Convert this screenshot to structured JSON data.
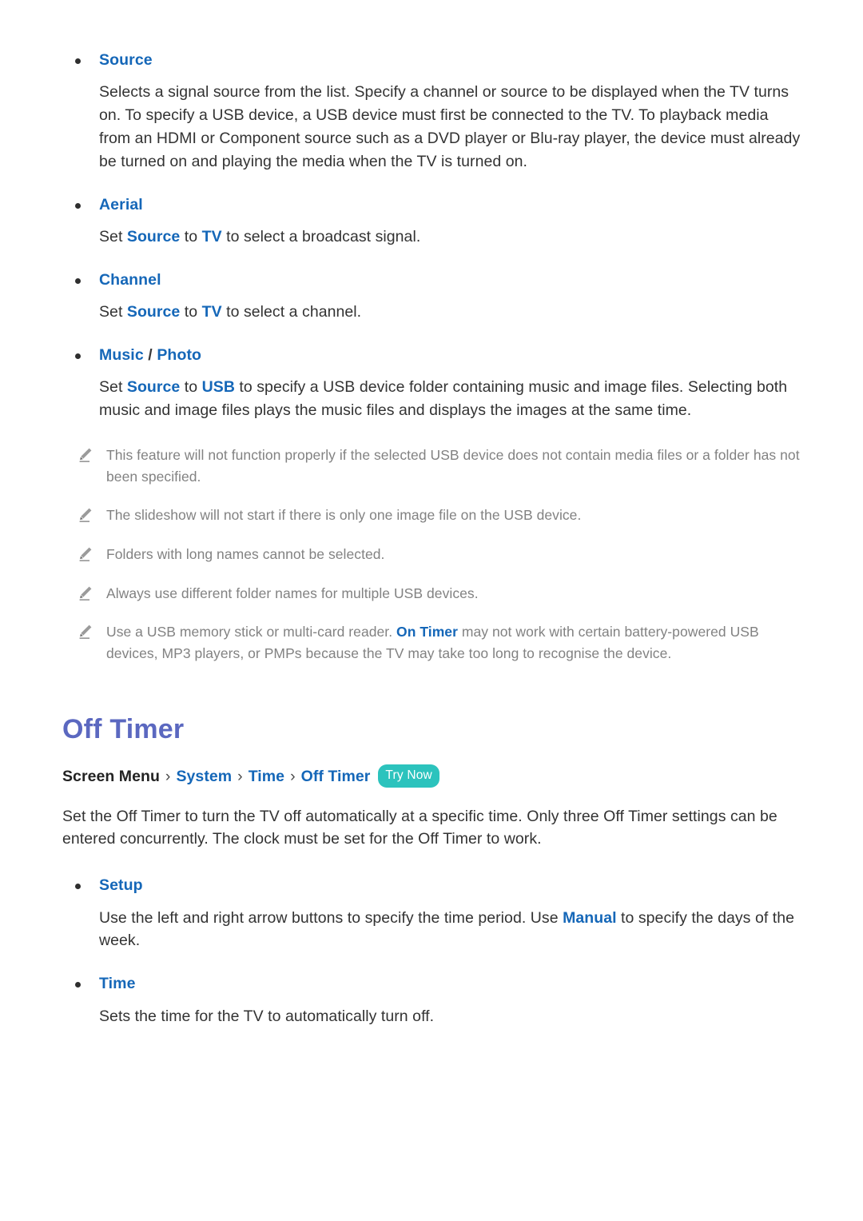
{
  "colors": {
    "link_blue": "#1567b8",
    "heading_purple": "#5b68c0",
    "badge_teal": "#2cc3bd",
    "body_text": "#333333",
    "note_text": "#828282",
    "page_background": "#ffffff"
  },
  "section_top": {
    "items": [
      {
        "label": "Source",
        "label_parts": [
          {
            "text": "Source",
            "style": "link"
          }
        ],
        "body": "Selects a signal source from the list. Specify a channel or source to be displayed when the TV turns on. To specify a USB device, a USB device must first be connected to the TV. To playback media from an HDMI or Component source such as a DVD player or Blu-ray player, the device must already be turned on and playing the media when the TV is turned on."
      },
      {
        "label": "Aerial",
        "body_prefix": "Set ",
        "body_link1": "Source",
        "body_mid": " to ",
        "body_link2": "TV",
        "body_suffix": " to select a broadcast signal."
      },
      {
        "label": "Channel",
        "body_prefix": "Set ",
        "body_link1": "Source",
        "body_mid": " to ",
        "body_link2": "TV",
        "body_suffix": " to select a channel."
      },
      {
        "label_a": "Music",
        "label_sep": " / ",
        "label_b": "Photo",
        "body_prefix": "Set ",
        "body_link1": "Source",
        "body_mid": " to ",
        "body_link2": "USB",
        "body_suffix": " to specify a USB device folder containing music and image files. Selecting both music and image files plays the music files and displays the images at the same time."
      }
    ],
    "notes": [
      {
        "icon": "pencil-icon",
        "text": "This feature will not function properly if the selected USB device does not contain media files or a folder has not been specified."
      },
      {
        "icon": "pencil-icon",
        "text": "The slideshow will not start if there is only one image file on the USB device."
      },
      {
        "icon": "pencil-icon",
        "text": "Folders with long names cannot be selected."
      },
      {
        "icon": "pencil-icon",
        "text": "Always use different folder names for multiple USB devices."
      },
      {
        "icon": "pencil-icon",
        "text_prefix": "Use a USB memory stick or multi-card reader. ",
        "text_link": "On Timer",
        "text_suffix": " may not work with certain battery-powered USB devices, MP3 players, or PMPs because the TV may take too long to recognise the device."
      }
    ]
  },
  "section_off_timer": {
    "heading": "Off Timer",
    "breadcrumb": {
      "root": "Screen Menu",
      "separator": "›",
      "crumbs": [
        "System",
        "Time",
        "Off Timer"
      ],
      "badge": "Try Now"
    },
    "intro": "Set the Off Timer to turn the TV off automatically at a specific time. Only three Off Timer settings can be entered concurrently. The clock must be set for the Off Timer to work.",
    "items": [
      {
        "label": "Setup",
        "body_prefix": "Use the left and right arrow buttons to specify the time period. Use ",
        "body_link": "Manual",
        "body_suffix": " to specify the days of the week."
      },
      {
        "label": "Time",
        "body": "Sets the time for the TV to automatically turn off."
      }
    ]
  }
}
